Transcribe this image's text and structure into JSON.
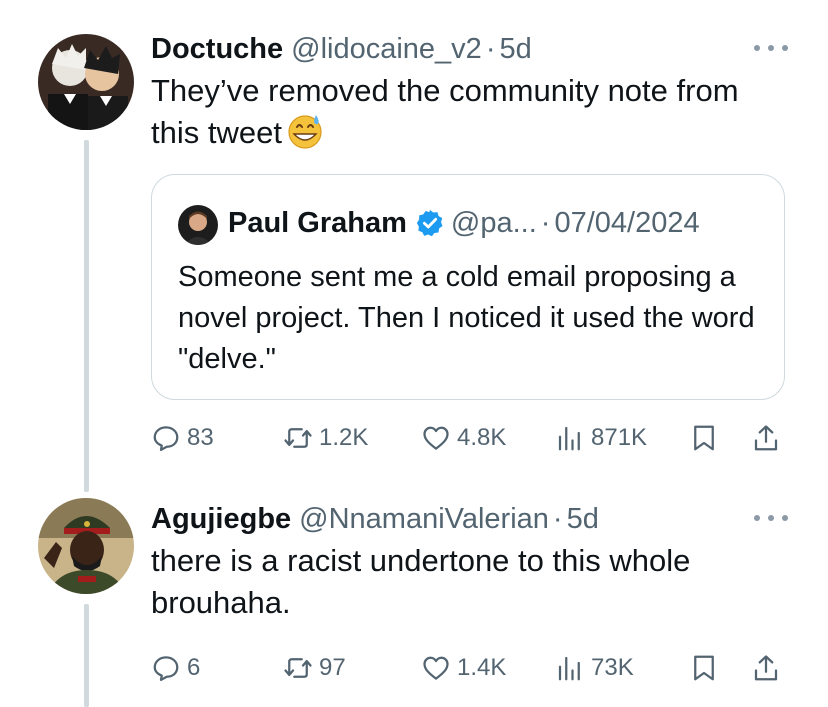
{
  "tweets": [
    {
      "name": "Doctuche",
      "handle": "@lidocaine_v2",
      "dot": "·",
      "time": "5d",
      "text": "They’ve removed the community note from this tweet",
      "emoji": "grinning-sweat-emoji",
      "quote": {
        "name": "Paul Graham",
        "handle": "@pa...",
        "dot": "·",
        "date": "07/04/2024",
        "text": "Someone sent me a cold email proposing a novel project. Then I noticed it used the word \"delve.\""
      },
      "stats": {
        "replies": "83",
        "retweets": "1.2K",
        "likes": "4.8K",
        "views": "871K"
      }
    },
    {
      "name": "Agujiegbe",
      "handle": "@NnamaniValerian",
      "dot": "·",
      "time": "5d",
      "text": "there is a racist undertone to this whole brouhaha.",
      "stats": {
        "replies": "6",
        "retweets": "97",
        "likes": "1.4K",
        "views": "73K"
      }
    }
  ],
  "icons": {
    "reply": "reply-icon",
    "retweet": "retweet-icon",
    "like": "heart-icon",
    "views": "views-icon",
    "bookmark": "bookmark-icon",
    "share": "share-icon",
    "more": "more-icon",
    "verified": "verified-badge-icon"
  },
  "colors": {
    "text": "#0f1419",
    "secondary": "#536471",
    "border": "#cfd9de",
    "verified": "#1d9bf0"
  }
}
